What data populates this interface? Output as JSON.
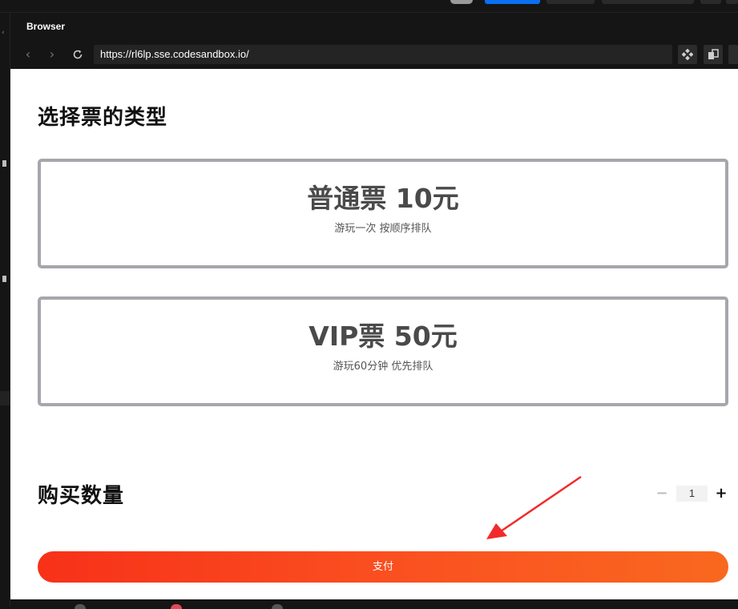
{
  "browser": {
    "title": "Browser",
    "url": "https://rl6lp.sse.codesandbox.io/"
  },
  "page": {
    "ticket_section_title": "选择票的类型",
    "tickets": [
      {
        "name": "普通票 10元",
        "description": "游玩一次 按顺序排队"
      },
      {
        "name": "VIP票 50元",
        "description": "游玩60分钟 优先排队"
      }
    ],
    "quantity_section_title": "购买数量",
    "quantity": {
      "minus": "−",
      "value": "1",
      "plus": "+"
    },
    "pay_label": "支付"
  },
  "colors": {
    "card_border": "#a6a6ac",
    "pay_gradient_start": "#f73119",
    "pay_gradient_end": "#f9681f",
    "annotation_arrow": "#f22a2a"
  }
}
